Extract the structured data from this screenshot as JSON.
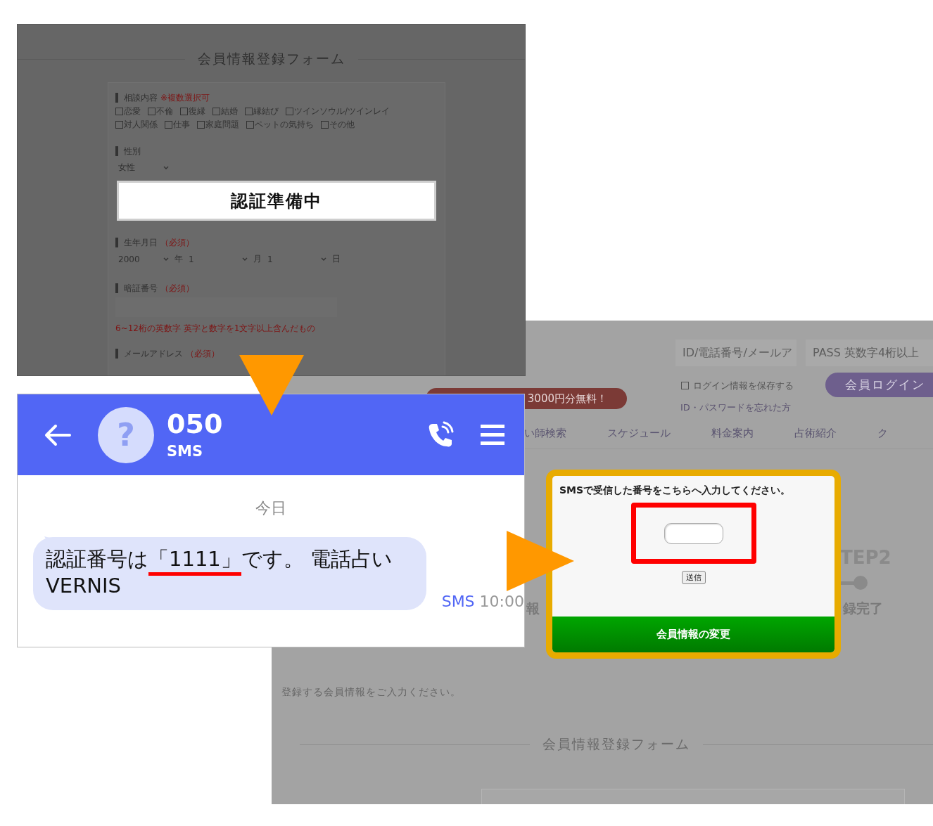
{
  "form_screen": {
    "title": "会員情報登録フォーム",
    "consult": {
      "label": "相談内容",
      "note": "※複数選択可",
      "options": [
        {
          "label": "恋愛",
          "checked": false
        },
        {
          "label": "不倫",
          "checked": false
        },
        {
          "label": "復縁",
          "checked": false
        },
        {
          "label": "結婚",
          "checked": false
        },
        {
          "label": "縁結び",
          "checked": false
        },
        {
          "label": "ツインソウル/ツインレイ",
          "checked": false
        },
        {
          "label": "対人関係",
          "checked": false
        },
        {
          "label": "仕事",
          "checked": false
        },
        {
          "label": "家庭問題",
          "checked": false
        },
        {
          "label": "ペットの気持ち",
          "checked": false
        },
        {
          "label": "その他",
          "checked": false
        }
      ]
    },
    "gender": {
      "label": "性別",
      "value": "女性"
    },
    "banner": "認証準備中",
    "birth": {
      "label": "生年月日",
      "required": "（必須）",
      "selects": [
        {
          "value": "2000",
          "unit": "年"
        },
        {
          "value": "1",
          "unit": "月"
        },
        {
          "value": "1",
          "unit": "日"
        }
      ]
    },
    "pin": {
      "label": "暗証番号",
      "required": "（必須）",
      "hint": "6~12桁の英数字 英字と数字を1文字以上含んだもの"
    },
    "email": {
      "label": "メールアドレス",
      "required": "（必須）"
    }
  },
  "site_screen": {
    "login": {
      "id_placeholder": "ID/電話番号/メールア",
      "pass_placeholder": "PASS 英数字4桁以上",
      "remember": {
        "label": "ログイン情報を保存する",
        "checked": false
      },
      "login_button": "会員ログイン",
      "forgot_link": "ID・パスワードを忘れた方"
    },
    "promo": "3000円分無料！",
    "nav": [
      "い師検索",
      "スケジュール",
      "料金案内",
      "占術紹介",
      "ク"
    ],
    "steps": {
      "left_label": "報",
      "right_title": "TEP2",
      "right_label": "録完了"
    },
    "intro": "登録する会員情報をご入力ください。",
    "form_title": "会員情報登録フォーム"
  },
  "sms_screen": {
    "contact": "050",
    "avatar_glyph": "?",
    "subtitle": "SMS",
    "date": "今日",
    "message": {
      "before": "認証番号は",
      "code": "「1111」",
      "after": "です。 電話占い VERNIS"
    },
    "channel": "SMS",
    "time": "10:00"
  },
  "popup": {
    "prompt": "SMSで受信した番号をこちらへ入力してください。",
    "submit": "送信",
    "change_button": "会員情報の変更"
  }
}
